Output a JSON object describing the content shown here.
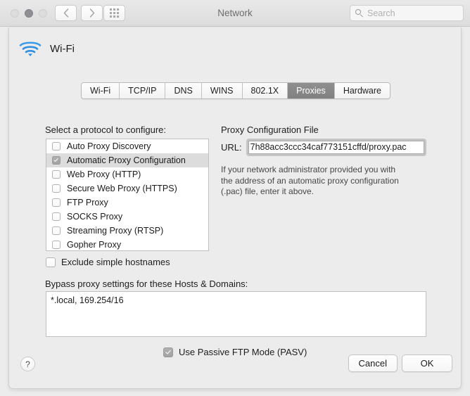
{
  "window": {
    "title": "Network",
    "traffic_lights": [
      "close",
      "minimize",
      "zoom"
    ],
    "nav": {
      "back_icon": "chevron-left-icon",
      "forward_icon": "chevron-right-icon",
      "grid_icon": "show-all-grid-icon"
    },
    "search": {
      "placeholder": "Search",
      "value": "",
      "icon": "search-icon"
    }
  },
  "sheet": {
    "service": {
      "name": "Wi-Fi",
      "icon": "wifi-icon",
      "icon_color": "#2f8fe0"
    },
    "tabs": [
      {
        "label": "Wi-Fi",
        "selected": false
      },
      {
        "label": "TCP/IP",
        "selected": false
      },
      {
        "label": "DNS",
        "selected": false
      },
      {
        "label": "WINS",
        "selected": false
      },
      {
        "label": "802.1X",
        "selected": false
      },
      {
        "label": "Proxies",
        "selected": true
      },
      {
        "label": "Hardware",
        "selected": false
      }
    ],
    "protocol_section": {
      "label": "Select a protocol to configure:",
      "items": [
        {
          "label": "Auto Proxy Discovery",
          "checked": false,
          "selected": false
        },
        {
          "label": "Automatic Proxy Configuration",
          "checked": true,
          "selected": true
        },
        {
          "label": "Web Proxy (HTTP)",
          "checked": false,
          "selected": false
        },
        {
          "label": "Secure Web Proxy (HTTPS)",
          "checked": false,
          "selected": false
        },
        {
          "label": "FTP Proxy",
          "checked": false,
          "selected": false
        },
        {
          "label": "SOCKS Proxy",
          "checked": false,
          "selected": false
        },
        {
          "label": "Streaming Proxy (RTSP)",
          "checked": false,
          "selected": false
        },
        {
          "label": "Gopher Proxy",
          "checked": false,
          "selected": false
        }
      ],
      "exclude_simple_hostnames": {
        "label": "Exclude simple hostnames",
        "checked": false
      }
    },
    "proxy_config_file": {
      "label": "Proxy Configuration File",
      "url_label": "URL:",
      "url_value": "7h88acc3ccc34caf773151cffd/proxy.pac",
      "help_text": "If your network administrator provided you with the address of an automatic proxy configuration (.pac) file, enter it above."
    },
    "bypass": {
      "label": "Bypass proxy settings for these Hosts & Domains:",
      "value": "*.local, 169.254/16"
    },
    "passive_ftp": {
      "label": "Use Passive FTP Mode (PASV)",
      "checked": true
    },
    "footer": {
      "help_label": "?",
      "cancel_label": "Cancel",
      "ok_label": "OK"
    }
  }
}
